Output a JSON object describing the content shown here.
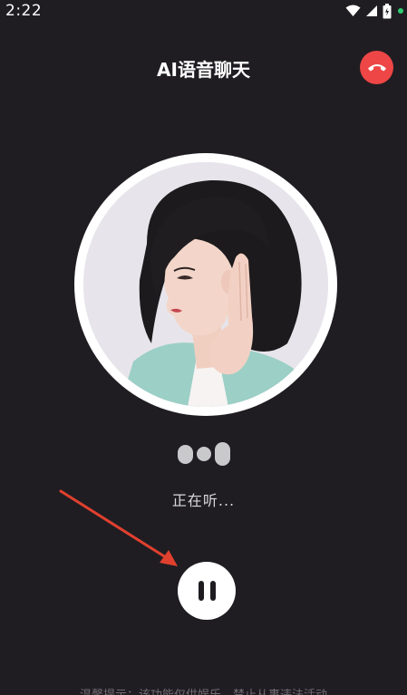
{
  "status_bar": {
    "time": "2:22",
    "icons": [
      "wifi-icon",
      "signal-icon",
      "battery-icon",
      "notification-dot"
    ]
  },
  "header": {
    "title": "AI语音聊天",
    "hangup_icon": "phone-hangup-icon",
    "hangup_color": "#ee4646"
  },
  "avatar": {
    "description_icon": "ai-avatar-portrait"
  },
  "status": {
    "listening_text": "正在听..."
  },
  "controls": {
    "pause_icon": "pause-icon"
  },
  "annotation": {
    "arrow_color": "#e0402e"
  },
  "footer": {
    "notice": "温馨提示：该功能仅供娱乐，禁止从事违法活动"
  },
  "colors": {
    "background": "#1f1d22",
    "accent_red": "#ee4646",
    "text_primary": "#ffffff",
    "text_secondary": "#d9d9dc"
  }
}
